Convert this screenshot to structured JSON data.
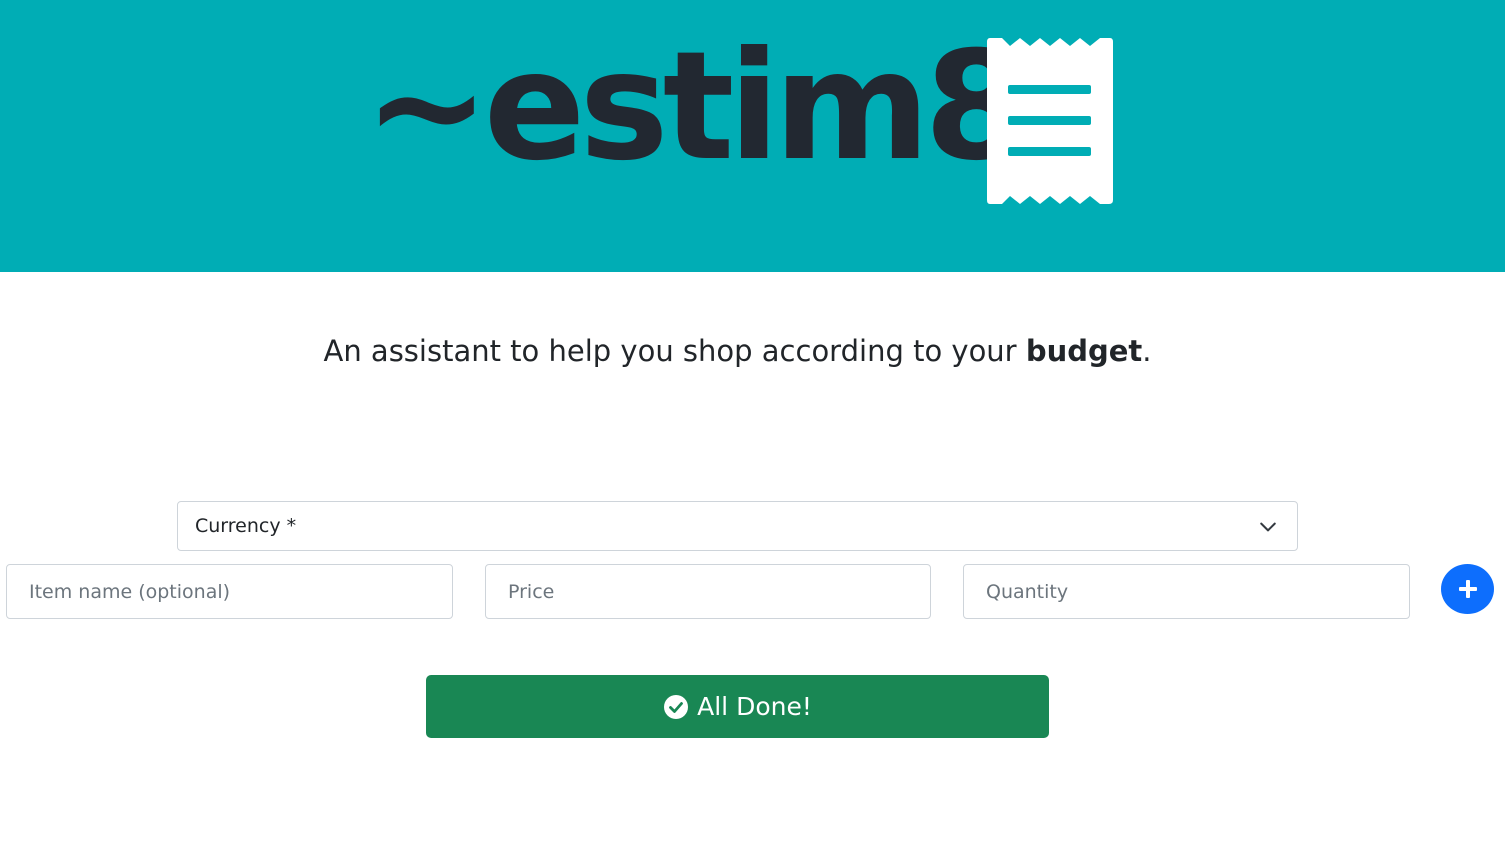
{
  "header": {
    "logo_text": "~estim8",
    "logo_icon": "receipt-icon",
    "background_color": "#00adb5",
    "logo_color": "#222831"
  },
  "tagline": {
    "prefix": "An assistant to help you shop according to your ",
    "emphasis": "budget",
    "suffix": "."
  },
  "form": {
    "currency": {
      "selected": "Currency *",
      "icon": "chevron-down-icon"
    },
    "item_name": {
      "placeholder": "Item name (optional)"
    },
    "price": {
      "placeholder": "Price"
    },
    "quantity": {
      "placeholder": "Quantity"
    },
    "add_button": {
      "icon": "plus-icon",
      "color": "#0d6efd"
    },
    "done_button": {
      "label": "All Done!",
      "icon": "check-circle-icon",
      "color": "#198754"
    }
  }
}
